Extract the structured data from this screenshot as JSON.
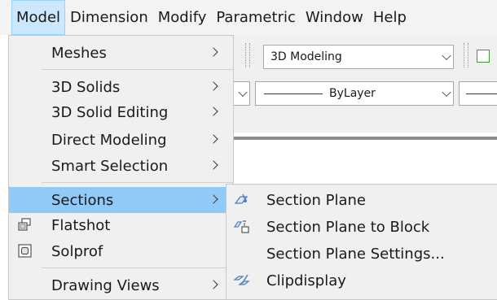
{
  "menubar": {
    "items": [
      {
        "label": "Model",
        "active": true
      },
      {
        "label": "Dimension"
      },
      {
        "label": "Modify"
      },
      {
        "label": "Parametric"
      },
      {
        "label": "Window"
      },
      {
        "label": "Help"
      }
    ]
  },
  "toolbar": {
    "workspace_value": "3D Modeling",
    "layer_value": "ByLayer"
  },
  "model_menu": {
    "items": [
      {
        "label": "Meshes",
        "submenu": true
      },
      {
        "label": "3D Solids",
        "submenu": true
      },
      {
        "label": "3D Solid Editing",
        "submenu": true
      },
      {
        "label": "Direct Modeling",
        "submenu": true
      },
      {
        "label": "Smart Selection",
        "submenu": true
      },
      {
        "label": "Sections",
        "submenu": true,
        "highlighted": true
      },
      {
        "label": "Flatshot",
        "icon": "flatshot-icon"
      },
      {
        "label": "Solprof",
        "icon": "solprof-icon"
      },
      {
        "label": "Drawing Views",
        "submenu": true
      }
    ]
  },
  "sections_submenu": {
    "items": [
      {
        "label": "Section Plane",
        "icon": "section-plane-icon"
      },
      {
        "label": "Section Plane to Block",
        "icon": "section-plane-to-block-icon"
      },
      {
        "label": "Section Plane Settings..."
      },
      {
        "label": "Clipdisplay",
        "icon": "clipdisplay-icon"
      }
    ]
  },
  "colors": {
    "highlight": "#91c9f7",
    "menubar_active": "#cce8ff",
    "menu_bg": "#f0f0f0",
    "icon_blue": "#4a7fc1"
  }
}
